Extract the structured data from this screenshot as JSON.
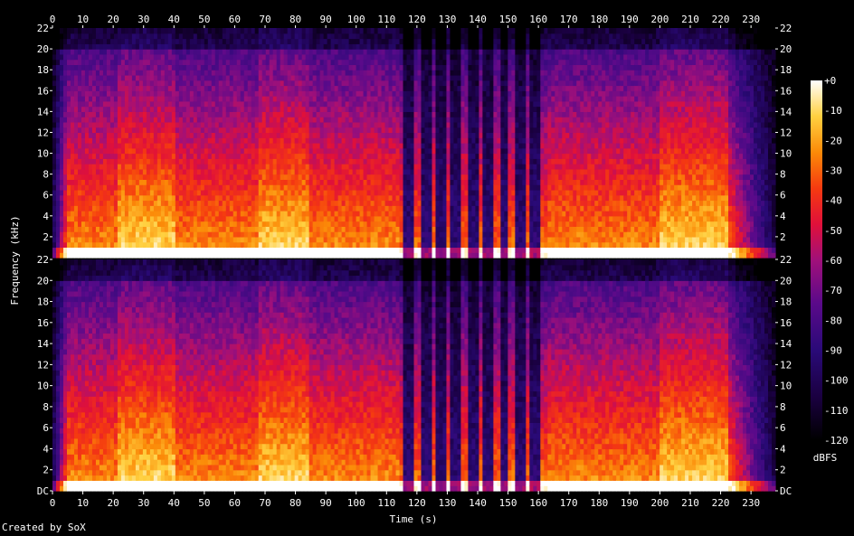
{
  "credit": "Created by SoX",
  "chart_data": {
    "type": "heatmap",
    "title": "",
    "xlabel": "Time (s)",
    "ylabel": "Frequency (kHz)",
    "colorbar_label": "dBFS",
    "xlim": [
      0,
      238
    ],
    "ylim_khz": [
      0,
      22
    ],
    "clim_dbfs": [
      -120,
      0
    ],
    "x_ticks": [
      "0",
      "10",
      "20",
      "30",
      "40",
      "50",
      "60",
      "70",
      "80",
      "90",
      "100",
      "110",
      "120",
      "130",
      "140",
      "150",
      "160",
      "170",
      "180",
      "190",
      "200",
      "210",
      "220",
      "230"
    ],
    "y_ticks": [
      "DC",
      "2",
      "4",
      "6",
      "8",
      "10",
      "12",
      "14",
      "16",
      "18",
      "20",
      "22"
    ],
    "colorbar_ticks": [
      "+0",
      "-10",
      "-20",
      "-30",
      "-40",
      "-50",
      "-60",
      "-70",
      "-80",
      "-90",
      "-100",
      "-110",
      "-120"
    ],
    "channels": 2,
    "segments": [
      {
        "start_s": 0,
        "end_s": 5,
        "level": "quiet"
      },
      {
        "start_s": 5,
        "end_s": 22,
        "level": "loud"
      },
      {
        "start_s": 22,
        "end_s": 40,
        "level": "very loud"
      },
      {
        "start_s": 40,
        "end_s": 68,
        "level": "loud"
      },
      {
        "start_s": 68,
        "end_s": 84,
        "level": "very loud"
      },
      {
        "start_s": 84,
        "end_s": 114,
        "level": "loud"
      },
      {
        "start_s": 114,
        "end_s": 163,
        "level": "sparse bursts"
      },
      {
        "start_s": 163,
        "end_s": 200,
        "level": "loud"
      },
      {
        "start_s": 200,
        "end_s": 222,
        "level": "very loud"
      },
      {
        "start_s": 222,
        "end_s": 238,
        "level": "fade out"
      }
    ]
  }
}
